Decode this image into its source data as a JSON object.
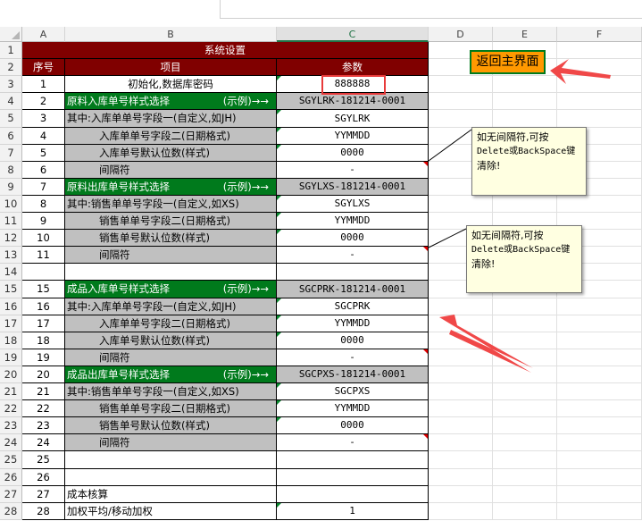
{
  "columns": [
    "A",
    "B",
    "C",
    "D",
    "E",
    "F"
  ],
  "title": "系统设置",
  "headers": {
    "seq": "序号",
    "item": "项目",
    "param": "参数"
  },
  "rows": [
    {
      "r": "1",
      "seq": "",
      "item": "",
      "param": ""
    },
    {
      "r": "2",
      "seq": "",
      "item": "",
      "param": ""
    },
    {
      "r": "3",
      "seq": "1",
      "item": "初始化,数据库密码",
      "param": "888888"
    },
    {
      "r": "4",
      "seq": "2",
      "item": "原料入库单号样式选择",
      "hint": "(示例)→→",
      "param": "SGYLRK-181214-0001"
    },
    {
      "r": "5",
      "seq": "3",
      "item": "其中:入库单单号字段一(自定义,如JH)",
      "param": "SGYLRK"
    },
    {
      "r": "6",
      "seq": "4",
      "item": "入库单单号字段二(日期格式)",
      "param": "YYMMDD"
    },
    {
      "r": "7",
      "seq": "5",
      "item": "入库单号默认位数(样式)",
      "param": "0000"
    },
    {
      "r": "8",
      "seq": "6",
      "item": "间隔符",
      "param": "-"
    },
    {
      "r": "9",
      "seq": "7",
      "item": "原料出库单号样式选择",
      "hint": "(示例)→→",
      "param": "SGYLXS-181214-0001"
    },
    {
      "r": "10",
      "seq": "8",
      "item": "其中:销售单单号字段一(自定义,如XS)",
      "param": "SGYLXS"
    },
    {
      "r": "11",
      "seq": "9",
      "item": "销售单单号字段二(日期格式)",
      "param": "YYMMDD"
    },
    {
      "r": "12",
      "seq": "10",
      "item": "销售单号默认位数(样式)",
      "param": "0000"
    },
    {
      "r": "13",
      "seq": "11",
      "item": "间隔符",
      "param": "-"
    },
    {
      "r": "14",
      "seq": "",
      "item": "",
      "param": ""
    },
    {
      "r": "15",
      "seq": "15",
      "item": "成品入库单号样式选择",
      "hint": "(示例)→→",
      "param": "SGCPRK-181214-0001"
    },
    {
      "r": "16",
      "seq": "16",
      "item": "其中:入库单单号字段一(自定义,如JH)",
      "param": "SGCPRK"
    },
    {
      "r": "17",
      "seq": "17",
      "item": "入库单单号字段二(日期格式)",
      "param": "YYMMDD"
    },
    {
      "r": "18",
      "seq": "18",
      "item": "入库单号默认位数(样式)",
      "param": "0000"
    },
    {
      "r": "19",
      "seq": "19",
      "item": "间隔符",
      "param": "-"
    },
    {
      "r": "20",
      "seq": "20",
      "item": "成品出库单号样式选择",
      "hint": "(示例)→→",
      "param": "SGCPXS-181214-0001"
    },
    {
      "r": "21",
      "seq": "21",
      "item": "其中:销售单单号字段一(自定义,如XS)",
      "param": "SGCPXS"
    },
    {
      "r": "22",
      "seq": "22",
      "item": "销售单单号字段二(日期格式)",
      "param": "YYMMDD"
    },
    {
      "r": "23",
      "seq": "23",
      "item": "销售单号默认位数(样式)",
      "param": "0000"
    },
    {
      "r": "24",
      "seq": "24",
      "item": "间隔符",
      "param": "-"
    },
    {
      "r": "25",
      "seq": "25",
      "item": "",
      "param": ""
    },
    {
      "r": "26",
      "seq": "26",
      "item": "",
      "param": ""
    },
    {
      "r": "27",
      "seq": "27",
      "item": "成本核算",
      "param": ""
    },
    {
      "r": "28",
      "seq": "28",
      "item": "加权平均/移动加权",
      "param": "1"
    }
  ],
  "back_button": "返回主界面",
  "notes": [
    {
      "line1": "如无间隔符,可按",
      "line2": "Delete或BackSpace键",
      "line3": "清除!"
    },
    {
      "line1": "如无间隔符,可按",
      "line2": "Delete或BackSpace键",
      "line3": "清除!"
    }
  ],
  "colors": {
    "header": "#800000",
    "green": "#007a1c",
    "gray": "#c0c0c0",
    "button": "#ff9900",
    "arrow": "#f04848"
  }
}
